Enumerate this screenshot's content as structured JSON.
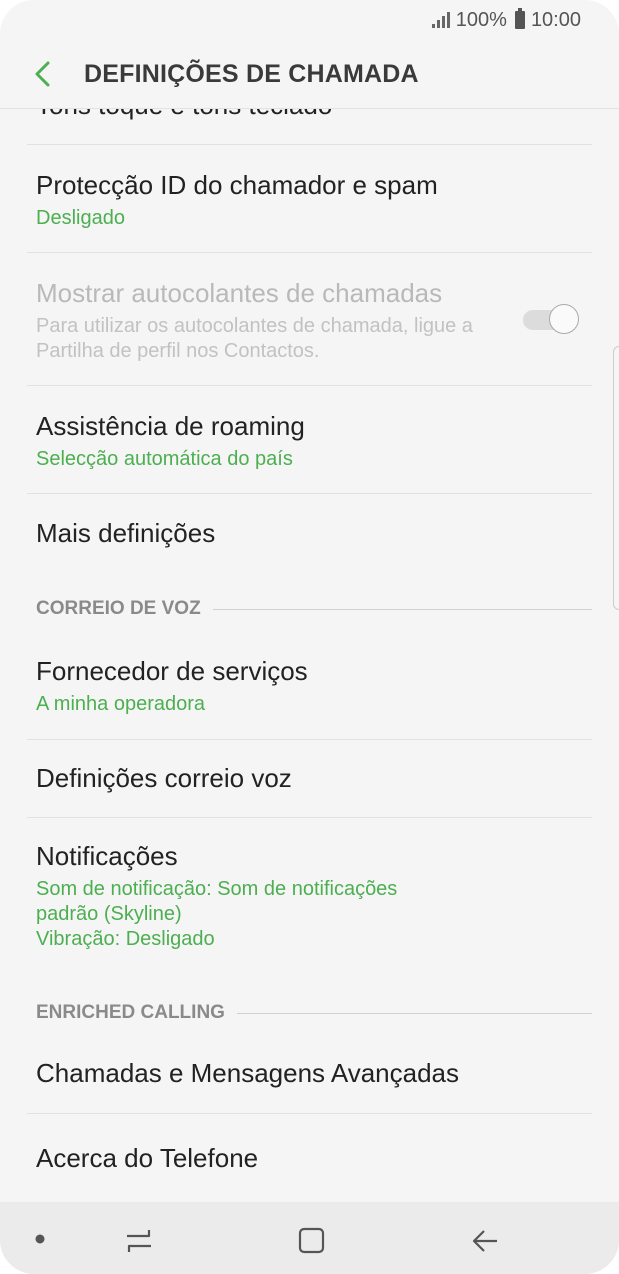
{
  "status": {
    "battery": "100%",
    "time": "10:00"
  },
  "appbar": {
    "title": "DEFINIÇÕES DE CHAMADA"
  },
  "items": [
    {
      "title": "Tons toque e tons teclado"
    },
    {
      "title": "Protecção ID do chamador e spam",
      "subtitle": "Desligado"
    },
    {
      "title": "Mostrar autocolantes de chamadas",
      "subtitle": "Para utilizar os autocolantes de chamada, ligue a Partilha de perfil nos Contactos.",
      "toggle_on": true
    },
    {
      "title": "Assistência de roaming",
      "subtitle": "Selecção automática do país"
    },
    {
      "title": "Mais definições"
    }
  ],
  "section_voicemail": {
    "header": "CORREIO DE VOZ",
    "items": [
      {
        "title": "Fornecedor de serviços",
        "subtitle": "A minha operadora"
      },
      {
        "title": "Definições correio voz"
      },
      {
        "title": "Notificações",
        "subtitle": "Som de notificação: Som de notificações padrão (Skyline)\nVibração: Desligado"
      }
    ]
  },
  "section_enriched": {
    "header": "ENRICHED CALLING",
    "items": [
      {
        "title": "Chamadas e Mensagens Avançadas"
      },
      {
        "title": "Acerca do Telefone"
      }
    ]
  },
  "colors": {
    "accent": "#4caf50",
    "text": "#222222",
    "disabled": "#b9b9b9"
  },
  "navbar_icons": [
    "dot-icon",
    "recent-apps-icon",
    "home-icon",
    "back-icon"
  ]
}
